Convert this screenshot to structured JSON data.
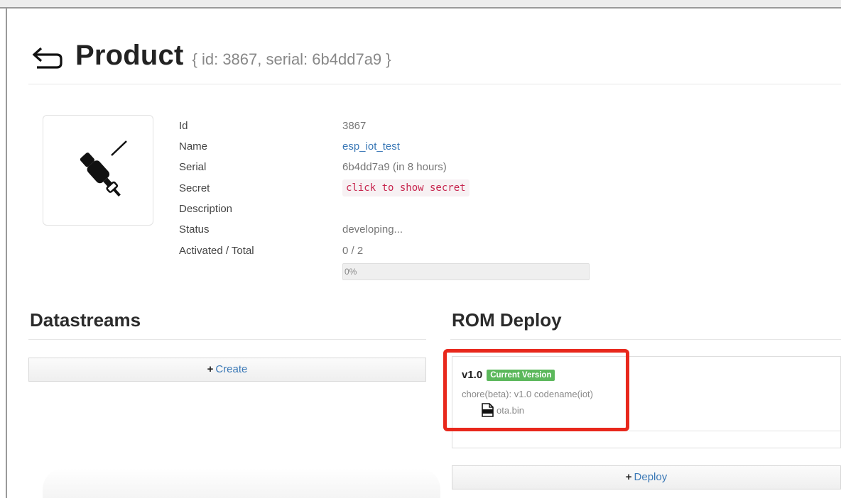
{
  "header": {
    "title": "Product",
    "subtitle": "{ id: 3867, serial: 6b4dd7a9 }"
  },
  "icons": {
    "back": "back-arrow-icon",
    "product": "connector-plug-icon",
    "file": "binary-file-icon"
  },
  "product": {
    "fields": [
      {
        "label": "Id",
        "value": "3867"
      },
      {
        "label": "Name",
        "value": "esp_iot_test"
      },
      {
        "label": "Serial",
        "value": "6b4dd7a9 (in 8 hours)"
      },
      {
        "label": "Secret",
        "value": "click to show secret"
      },
      {
        "label": "Description",
        "value": ""
      },
      {
        "label": "Status",
        "value": "developing..."
      },
      {
        "label": "Activated / Total",
        "value": "0 / 2"
      }
    ],
    "progress": {
      "percent": 0,
      "label": "0%"
    }
  },
  "datastreams": {
    "title": "Datastreams",
    "create_plus": "+",
    "create_label": "Create"
  },
  "rom_deploy": {
    "title": "ROM Deploy",
    "versions": [
      {
        "name": "v1.0",
        "badge": "Current Version",
        "message": "chore(beta): v1.0 codename(iot)",
        "file": "ota.bin"
      }
    ],
    "deploy_plus": "+",
    "deploy_label": "Deploy"
  },
  "colors": {
    "link": "#3a78b6",
    "secret_text": "#c7254e",
    "badge_green": "#5cb85c",
    "highlight_red": "#e8281c"
  }
}
